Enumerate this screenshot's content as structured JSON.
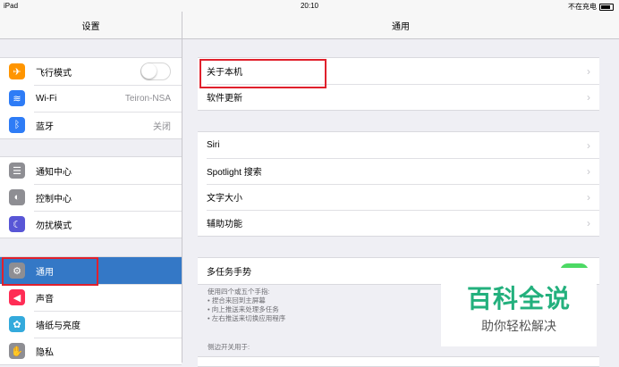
{
  "status": {
    "device": "iPad",
    "time": "20:10",
    "charging": "不在充电"
  },
  "master": {
    "title": "设置",
    "group1": [
      {
        "label": "飞行模式",
        "icon": "airplane-icon",
        "color": "#ff9500",
        "glyph": "✈",
        "toggle": true
      },
      {
        "label": "Wi-Fi",
        "icon": "wifi-icon",
        "color": "#2e7cf6",
        "glyph": "≋",
        "value": "Teiron-NSA"
      },
      {
        "label": "蓝牙",
        "icon": "bluetooth-icon",
        "color": "#2e7cf6",
        "glyph": "ᛒ",
        "value": "关闭"
      }
    ],
    "group2": [
      {
        "label": "通知中心",
        "icon": "notification-center-icon",
        "color": "#8e8e93",
        "glyph": "☰"
      },
      {
        "label": "控制中心",
        "icon": "control-center-icon",
        "color": "#8e8e93",
        "glyph": "◐"
      },
      {
        "label": "勿扰模式",
        "icon": "moon-icon",
        "color": "#5856d6",
        "glyph": "☾"
      }
    ],
    "group3": [
      {
        "label": "通用",
        "icon": "gear-icon",
        "color": "#8e8e93",
        "glyph": "⚙",
        "selected": true
      },
      {
        "label": "声音",
        "icon": "sound-icon",
        "color": "#ff2d55",
        "glyph": "◀"
      },
      {
        "label": "墙纸与亮度",
        "icon": "wallpaper-icon",
        "color": "#34aadc",
        "glyph": "✿"
      },
      {
        "label": "隐私",
        "icon": "privacy-icon",
        "color": "#8e8e93",
        "glyph": "✋"
      }
    ]
  },
  "detail": {
    "title": "通用",
    "group1": [
      "关于本机",
      "软件更新"
    ],
    "group2": [
      "Siri",
      "Spotlight 搜索",
      "文字大小",
      "辅助功能"
    ],
    "multitask": "多任务手势",
    "multitask_notes": [
      "使用四个或五个手指:",
      "• 捏合来回到主屏幕",
      "• 向上推送来处理多任务",
      "• 左右推送来切换应用程序"
    ],
    "side_switch": "侧边开关用于:"
  },
  "watermark": {
    "big": "百科全说",
    "small": "助你轻松解决"
  }
}
